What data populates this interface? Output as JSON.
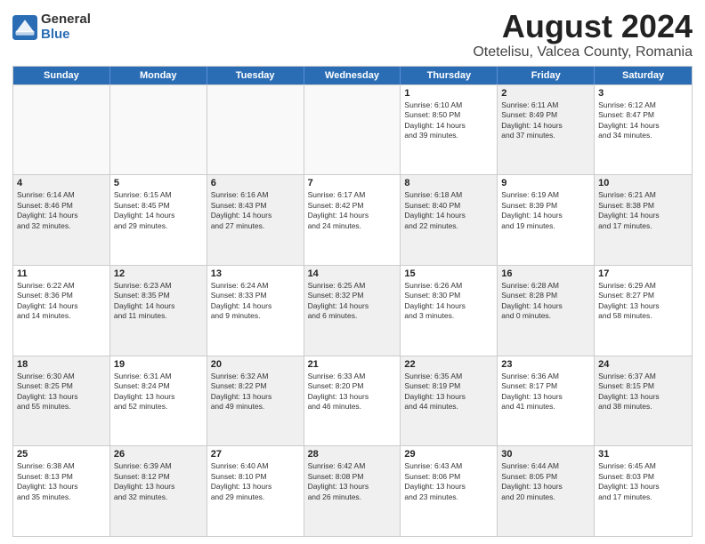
{
  "logo": {
    "general": "General",
    "blue": "Blue"
  },
  "title": "August 2024",
  "subtitle": "Otetelisu, Valcea County, Romania",
  "header_days": [
    "Sunday",
    "Monday",
    "Tuesday",
    "Wednesday",
    "Thursday",
    "Friday",
    "Saturday"
  ],
  "rows": [
    [
      {
        "day": "",
        "text": "",
        "shaded": false,
        "empty": true
      },
      {
        "day": "",
        "text": "",
        "shaded": false,
        "empty": true
      },
      {
        "day": "",
        "text": "",
        "shaded": false,
        "empty": true
      },
      {
        "day": "",
        "text": "",
        "shaded": false,
        "empty": true
      },
      {
        "day": "1",
        "text": "Sunrise: 6:10 AM\nSunset: 8:50 PM\nDaylight: 14 hours\nand 39 minutes.",
        "shaded": false,
        "empty": false
      },
      {
        "day": "2",
        "text": "Sunrise: 6:11 AM\nSunset: 8:49 PM\nDaylight: 14 hours\nand 37 minutes.",
        "shaded": true,
        "empty": false
      },
      {
        "day": "3",
        "text": "Sunrise: 6:12 AM\nSunset: 8:47 PM\nDaylight: 14 hours\nand 34 minutes.",
        "shaded": false,
        "empty": false
      }
    ],
    [
      {
        "day": "4",
        "text": "Sunrise: 6:14 AM\nSunset: 8:46 PM\nDaylight: 14 hours\nand 32 minutes.",
        "shaded": true,
        "empty": false
      },
      {
        "day": "5",
        "text": "Sunrise: 6:15 AM\nSunset: 8:45 PM\nDaylight: 14 hours\nand 29 minutes.",
        "shaded": false,
        "empty": false
      },
      {
        "day": "6",
        "text": "Sunrise: 6:16 AM\nSunset: 8:43 PM\nDaylight: 14 hours\nand 27 minutes.",
        "shaded": true,
        "empty": false
      },
      {
        "day": "7",
        "text": "Sunrise: 6:17 AM\nSunset: 8:42 PM\nDaylight: 14 hours\nand 24 minutes.",
        "shaded": false,
        "empty": false
      },
      {
        "day": "8",
        "text": "Sunrise: 6:18 AM\nSunset: 8:40 PM\nDaylight: 14 hours\nand 22 minutes.",
        "shaded": true,
        "empty": false
      },
      {
        "day": "9",
        "text": "Sunrise: 6:19 AM\nSunset: 8:39 PM\nDaylight: 14 hours\nand 19 minutes.",
        "shaded": false,
        "empty": false
      },
      {
        "day": "10",
        "text": "Sunrise: 6:21 AM\nSunset: 8:38 PM\nDaylight: 14 hours\nand 17 minutes.",
        "shaded": true,
        "empty": false
      }
    ],
    [
      {
        "day": "11",
        "text": "Sunrise: 6:22 AM\nSunset: 8:36 PM\nDaylight: 14 hours\nand 14 minutes.",
        "shaded": false,
        "empty": false
      },
      {
        "day": "12",
        "text": "Sunrise: 6:23 AM\nSunset: 8:35 PM\nDaylight: 14 hours\nand 11 minutes.",
        "shaded": true,
        "empty": false
      },
      {
        "day": "13",
        "text": "Sunrise: 6:24 AM\nSunset: 8:33 PM\nDaylight: 14 hours\nand 9 minutes.",
        "shaded": false,
        "empty": false
      },
      {
        "day": "14",
        "text": "Sunrise: 6:25 AM\nSunset: 8:32 PM\nDaylight: 14 hours\nand 6 minutes.",
        "shaded": true,
        "empty": false
      },
      {
        "day": "15",
        "text": "Sunrise: 6:26 AM\nSunset: 8:30 PM\nDaylight: 14 hours\nand 3 minutes.",
        "shaded": false,
        "empty": false
      },
      {
        "day": "16",
        "text": "Sunrise: 6:28 AM\nSunset: 8:28 PM\nDaylight: 14 hours\nand 0 minutes.",
        "shaded": true,
        "empty": false
      },
      {
        "day": "17",
        "text": "Sunrise: 6:29 AM\nSunset: 8:27 PM\nDaylight: 13 hours\nand 58 minutes.",
        "shaded": false,
        "empty": false
      }
    ],
    [
      {
        "day": "18",
        "text": "Sunrise: 6:30 AM\nSunset: 8:25 PM\nDaylight: 13 hours\nand 55 minutes.",
        "shaded": true,
        "empty": false
      },
      {
        "day": "19",
        "text": "Sunrise: 6:31 AM\nSunset: 8:24 PM\nDaylight: 13 hours\nand 52 minutes.",
        "shaded": false,
        "empty": false
      },
      {
        "day": "20",
        "text": "Sunrise: 6:32 AM\nSunset: 8:22 PM\nDaylight: 13 hours\nand 49 minutes.",
        "shaded": true,
        "empty": false
      },
      {
        "day": "21",
        "text": "Sunrise: 6:33 AM\nSunset: 8:20 PM\nDaylight: 13 hours\nand 46 minutes.",
        "shaded": false,
        "empty": false
      },
      {
        "day": "22",
        "text": "Sunrise: 6:35 AM\nSunset: 8:19 PM\nDaylight: 13 hours\nand 44 minutes.",
        "shaded": true,
        "empty": false
      },
      {
        "day": "23",
        "text": "Sunrise: 6:36 AM\nSunset: 8:17 PM\nDaylight: 13 hours\nand 41 minutes.",
        "shaded": false,
        "empty": false
      },
      {
        "day": "24",
        "text": "Sunrise: 6:37 AM\nSunset: 8:15 PM\nDaylight: 13 hours\nand 38 minutes.",
        "shaded": true,
        "empty": false
      }
    ],
    [
      {
        "day": "25",
        "text": "Sunrise: 6:38 AM\nSunset: 8:13 PM\nDaylight: 13 hours\nand 35 minutes.",
        "shaded": false,
        "empty": false
      },
      {
        "day": "26",
        "text": "Sunrise: 6:39 AM\nSunset: 8:12 PM\nDaylight: 13 hours\nand 32 minutes.",
        "shaded": true,
        "empty": false
      },
      {
        "day": "27",
        "text": "Sunrise: 6:40 AM\nSunset: 8:10 PM\nDaylight: 13 hours\nand 29 minutes.",
        "shaded": false,
        "empty": false
      },
      {
        "day": "28",
        "text": "Sunrise: 6:42 AM\nSunset: 8:08 PM\nDaylight: 13 hours\nand 26 minutes.",
        "shaded": true,
        "empty": false
      },
      {
        "day": "29",
        "text": "Sunrise: 6:43 AM\nSunset: 8:06 PM\nDaylight: 13 hours\nand 23 minutes.",
        "shaded": false,
        "empty": false
      },
      {
        "day": "30",
        "text": "Sunrise: 6:44 AM\nSunset: 8:05 PM\nDaylight: 13 hours\nand 20 minutes.",
        "shaded": true,
        "empty": false
      },
      {
        "day": "31",
        "text": "Sunrise: 6:45 AM\nSunset: 8:03 PM\nDaylight: 13 hours\nand 17 minutes.",
        "shaded": false,
        "empty": false
      }
    ]
  ]
}
